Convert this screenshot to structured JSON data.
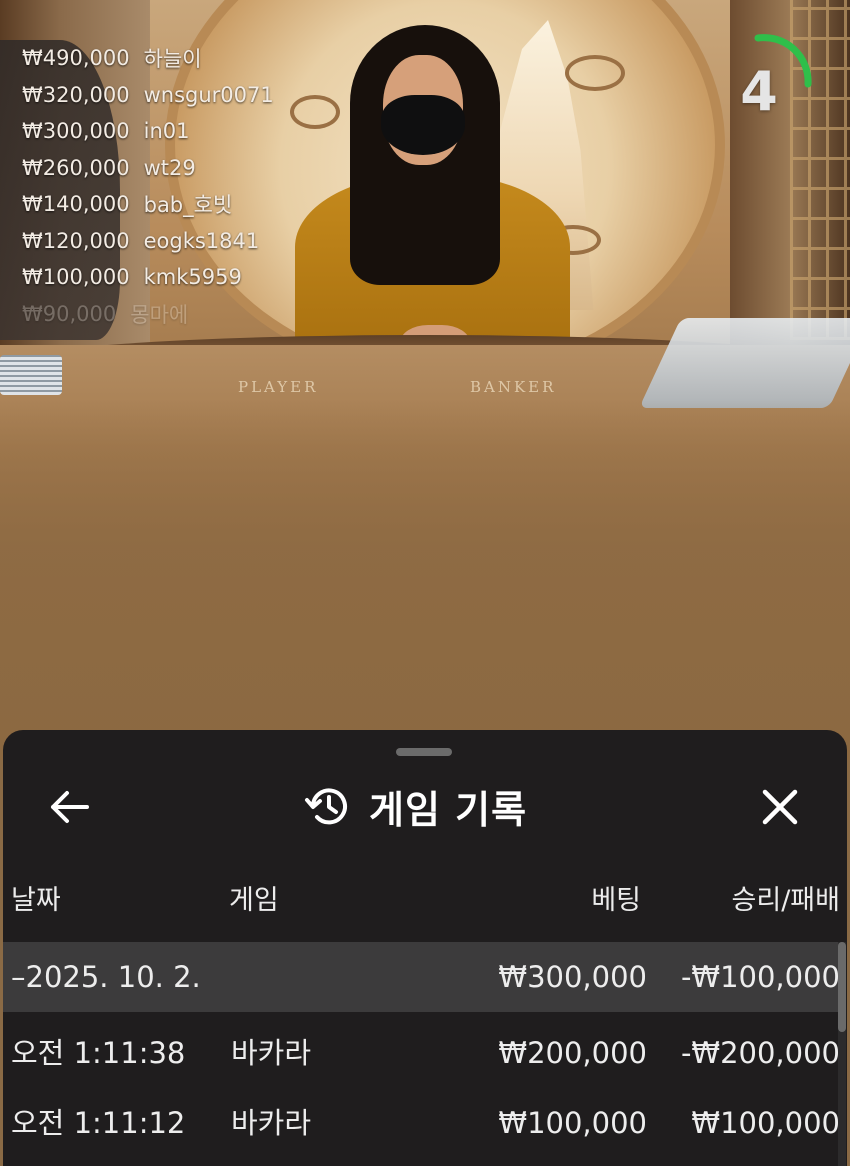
{
  "live": {
    "table_labels": {
      "player": "PLAYER",
      "banker": "BANKER"
    },
    "countdown": "4",
    "countdown_color": "#2fbf4a",
    "leaderboard": [
      {
        "amount": "₩490,000",
        "name": "하늘이"
      },
      {
        "amount": "₩320,000",
        "name": "wnsgur0071"
      },
      {
        "amount": "₩300,000",
        "name": "in01"
      },
      {
        "amount": "₩260,000",
        "name": "wt29"
      },
      {
        "amount": "₩140,000",
        "name": "bab_호빗"
      },
      {
        "amount": "₩120,000",
        "name": "eogks1841"
      },
      {
        "amount": "₩100,000",
        "name": "kmk5959"
      },
      {
        "amount": "₩90,000",
        "name": "몽마에"
      }
    ]
  },
  "sheet": {
    "title": "게임 기록",
    "icons": {
      "back": "arrow-left-icon",
      "history": "history-icon",
      "close": "close-icon"
    },
    "columns": {
      "date": "날짜",
      "game": "게임",
      "bet": "베팅",
      "result": "승리/패배"
    },
    "group": {
      "date": "–2025. 10. 2.",
      "bet": "₩300,000",
      "result": "-₩100,000"
    },
    "rows": [
      {
        "time": "오전 1:11:38",
        "game": "바카라",
        "bet": "₩200,000",
        "result": "-₩200,000"
      },
      {
        "time": "오전 1:11:12",
        "game": "바카라",
        "bet": "₩100,000",
        "result": "₩100,000"
      }
    ]
  }
}
